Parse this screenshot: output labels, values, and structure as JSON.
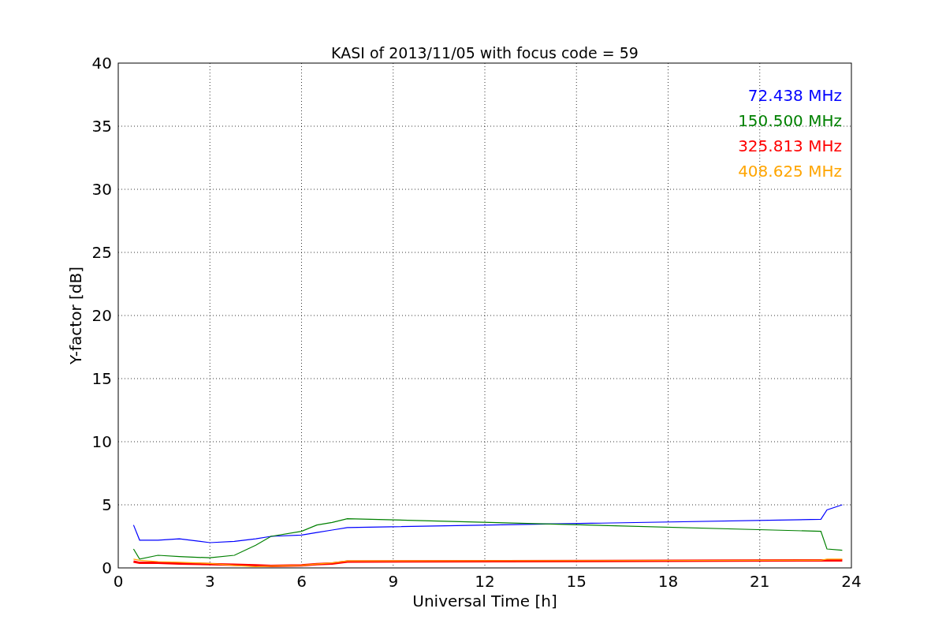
{
  "chart_data": {
    "type": "line",
    "title": "KASI of 2013/11/05 with focus code = 59",
    "xlabel": "Universal Time [h]",
    "ylabel": "Y-factor [dB]",
    "x": [
      0.5,
      0.7,
      1.3,
      2,
      3,
      3.8,
      4.5,
      5,
      6,
      6.5,
      7,
      7.5,
      23,
      23.2,
      23.7
    ],
    "series": [
      {
        "name": "72.438 MHz",
        "color": "#0000ff",
        "values": [
          3.4,
          2.2,
          2.2,
          2.3,
          2.0,
          2.1,
          2.3,
          2.5,
          2.6,
          2.8,
          3.0,
          3.2,
          3.85,
          4.6,
          5.0
        ]
      },
      {
        "name": "150.500 MHz",
        "color": "#008000",
        "values": [
          1.5,
          0.7,
          1.0,
          0.9,
          0.8,
          1.0,
          1.8,
          2.5,
          2.9,
          3.4,
          3.6,
          3.9,
          2.9,
          1.5,
          1.4
        ]
      },
      {
        "name": "325.813 MHz",
        "color": "#ff0000",
        "values": [
          0.5,
          0.4,
          0.4,
          0.35,
          0.3,
          0.25,
          0.2,
          0.15,
          0.2,
          0.3,
          0.35,
          0.5,
          0.6,
          0.6,
          0.6
        ]
      },
      {
        "name": "408.625 MHz",
        "color": "#ffa500",
        "values": [
          0.7,
          0.6,
          0.5,
          0.45,
          0.35,
          0.2,
          0.1,
          0.15,
          0.2,
          0.3,
          0.4,
          0.55,
          0.6,
          0.7,
          0.7
        ]
      }
    ],
    "xlim": [
      0,
      24
    ],
    "ylim": [
      0,
      40
    ],
    "xticks": [
      0,
      3,
      6,
      9,
      12,
      15,
      18,
      21,
      24
    ],
    "yticks": [
      0,
      5,
      10,
      15,
      20,
      25,
      30,
      35,
      40
    ],
    "grid": true
  }
}
